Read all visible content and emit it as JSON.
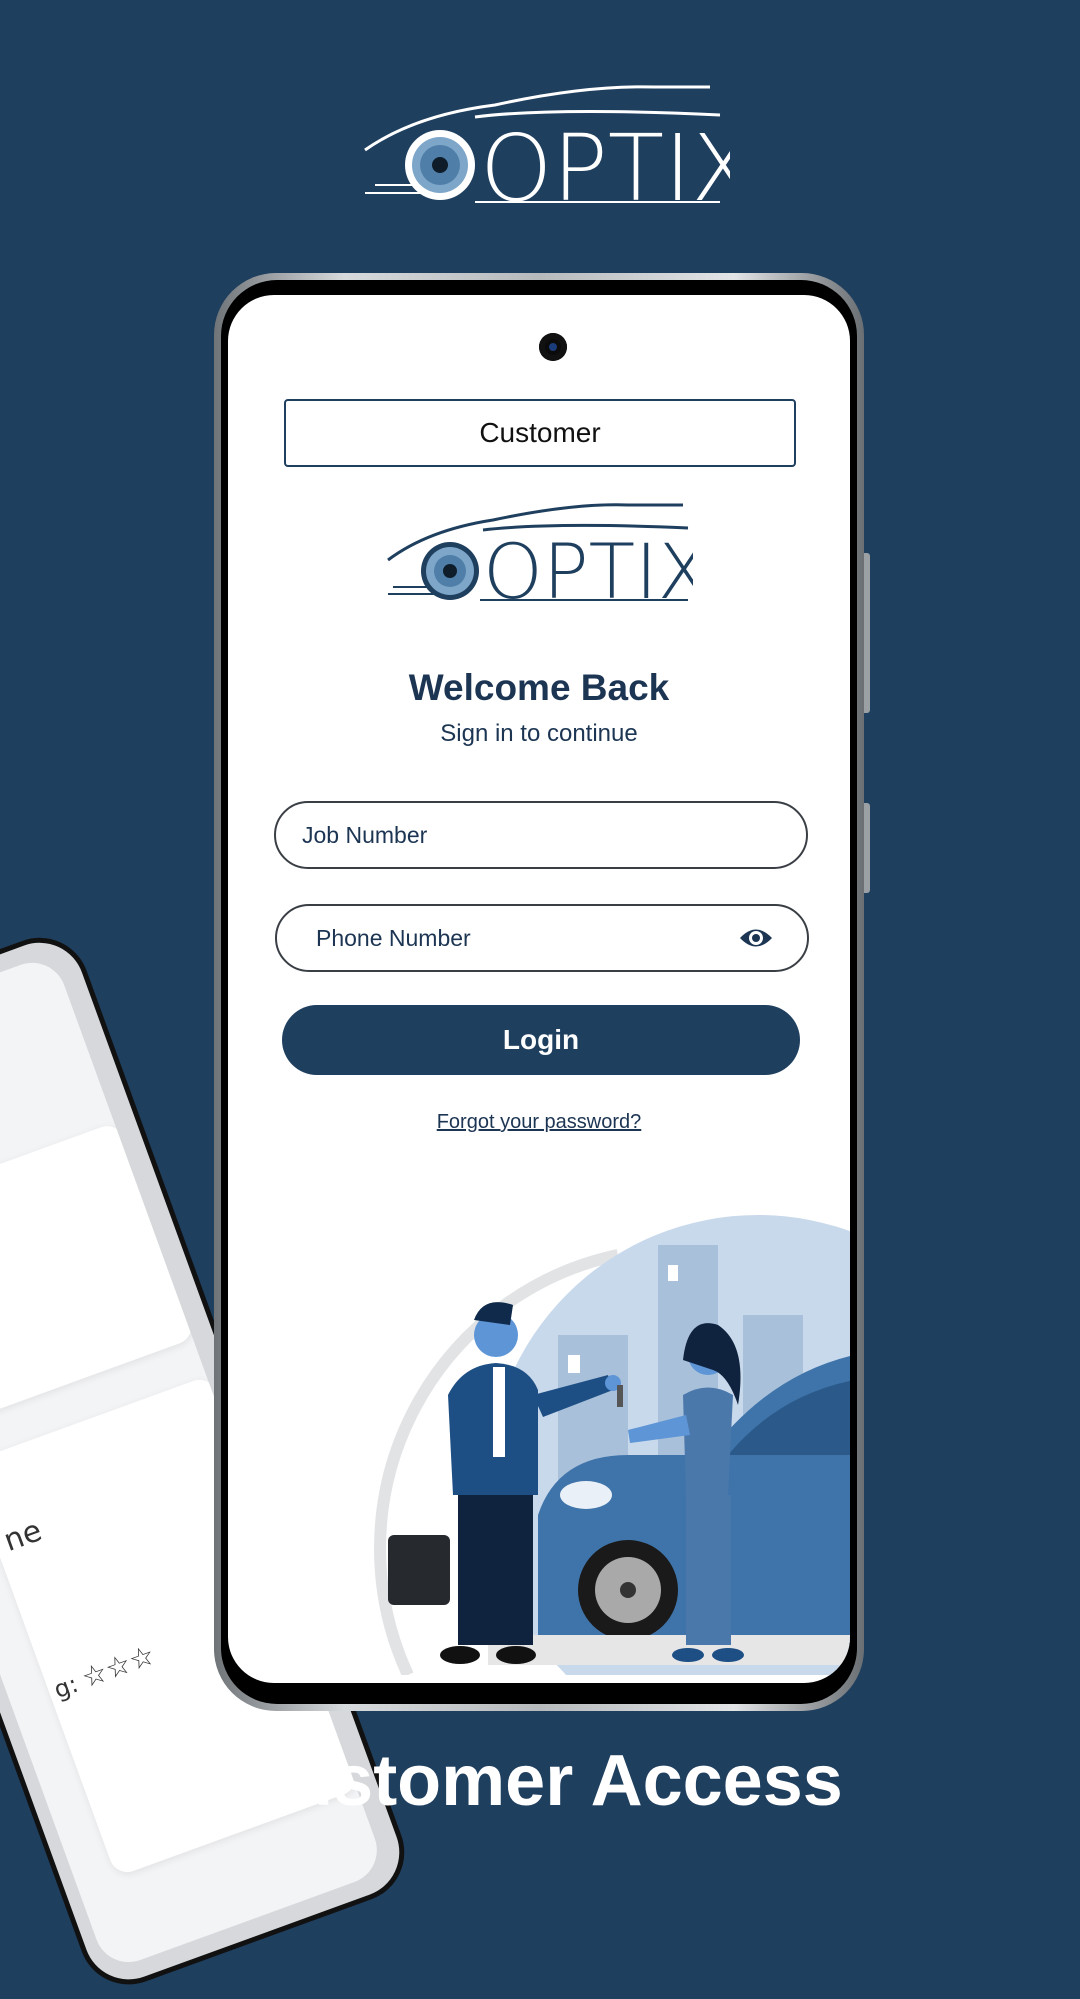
{
  "brand": {
    "logo_text": "OPTIX"
  },
  "colors": {
    "background": "#1f3f5f",
    "primary": "#1f3f5f",
    "text_dark": "#1c3553",
    "white": "#ffffff"
  },
  "login_screen": {
    "role_selector": "Customer",
    "logo_text": "OPTIX",
    "title": "Welcome Back",
    "subtitle": "Sign in to continue",
    "job_number": {
      "placeholder": "Job Number"
    },
    "phone_number": {
      "placeholder": "Phone Number",
      "visibility_icon": "eye-icon"
    },
    "login_button": "Login",
    "forgot_link": "Forgot your password?"
  },
  "background_phone": {
    "card_text": "ne",
    "rating_label": "g:",
    "stars": "☆☆☆"
  },
  "caption": "Customer Access"
}
